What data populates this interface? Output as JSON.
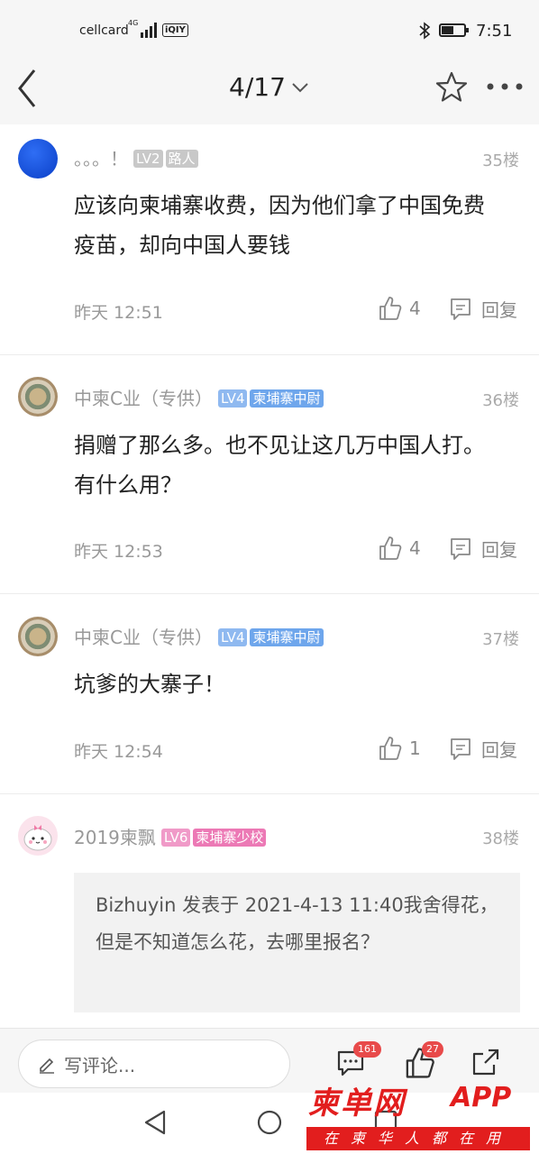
{
  "status_bar": {
    "carrier": "cellcard",
    "network": "4G",
    "app_badge": "iQIY",
    "time": "7:51"
  },
  "nav": {
    "page_indicator": "4/17"
  },
  "comments": [
    {
      "username": "。。。！",
      "level": "LV2",
      "title": "路人",
      "floor": "35楼",
      "content": "应该向柬埔寨收费，因为他们拿了中国免费疫苗，却向中国人要钱",
      "time": "昨天 12:51",
      "likes": "4",
      "reply_label": "回复"
    },
    {
      "username": "中柬C业（专供）",
      "level": "LV4",
      "title": "柬埔寨中尉",
      "floor": "36楼",
      "content": "捐赠了那么多。也不见让这几万中国人打。有什么用？",
      "time": "昨天 12:53",
      "likes": "4",
      "reply_label": "回复"
    },
    {
      "username": "中柬C业（专供）",
      "level": "LV4",
      "title": "柬埔寨中尉",
      "floor": "37楼",
      "content": "坑爹的大寨子！",
      "time": "昨天 12:54",
      "likes": "1",
      "reply_label": "回复"
    },
    {
      "username": "2019柬飘",
      "level": "LV6",
      "title": "柬埔寨少校",
      "floor": "38楼",
      "quote": "Bizhuyin 发表于 2021-4-13 11:40我舍得花，但是不知道怎么花，去哪里报名？"
    }
  ],
  "bottom_bar": {
    "comment_placeholder": "写评论...",
    "comment_count": "161",
    "like_count": "27"
  },
  "watermark": {
    "logo": "柬单网",
    "app": "APP",
    "slogan": "在柬华人都在用"
  },
  "colors": {
    "badge_blue": "#8fb9f0",
    "title_blue": "#6ea6ec",
    "badge_pink": "#f09ac8",
    "title_pink": "#ec79b5",
    "badge_grey": "#c8c8c8",
    "watermark_red": "#e21e1e"
  }
}
